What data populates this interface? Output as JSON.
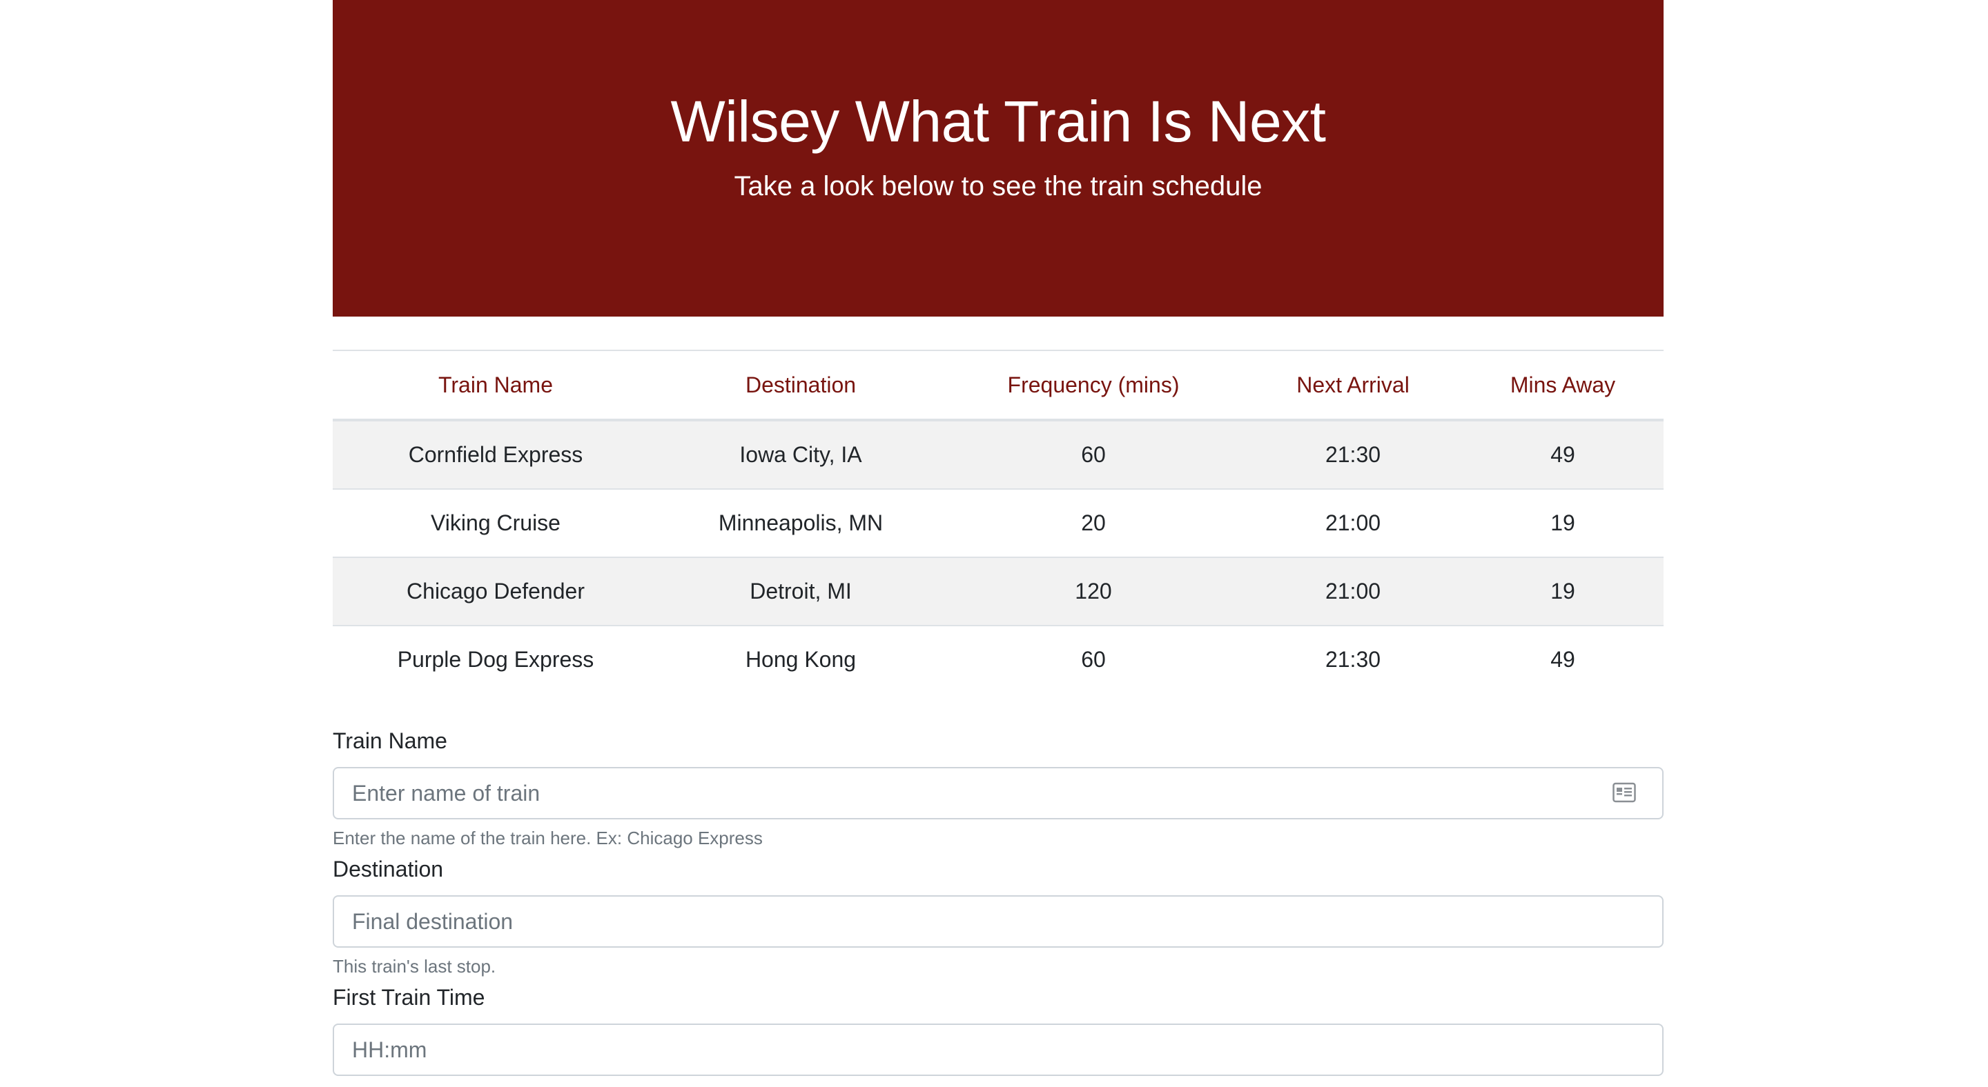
{
  "header": {
    "title": "Wilsey What Train Is Next",
    "subtitle": "Take a look below to see the train schedule"
  },
  "table": {
    "columns": [
      "Train Name",
      "Destination",
      "Frequency (mins)",
      "Next Arrival",
      "Mins Away"
    ],
    "rows": [
      [
        "Cornfield Express",
        "Iowa City, IA",
        "60",
        "21:30",
        "49"
      ],
      [
        "Viking Cruise",
        "Minneapolis, MN",
        "20",
        "21:00",
        "19"
      ],
      [
        "Chicago Defender",
        "Detroit, MI",
        "120",
        "21:00",
        "19"
      ],
      [
        "Purple Dog Express",
        "Hong Kong",
        "60",
        "21:30",
        "49"
      ]
    ]
  },
  "form": {
    "train_name": {
      "label": "Train Name",
      "placeholder": "Enter name of train",
      "help": "Enter the name of the train here. Ex: Chicago Express",
      "icon": "contact-card-icon"
    },
    "destination": {
      "label": "Destination",
      "placeholder": "Final destination",
      "help": "This train's last stop."
    },
    "first_time": {
      "label": "First Train Time",
      "placeholder": "HH:mm"
    }
  },
  "colors": {
    "brand": "#78140f",
    "stripe": "#f2f2f2",
    "border": "#dee2e6"
  }
}
